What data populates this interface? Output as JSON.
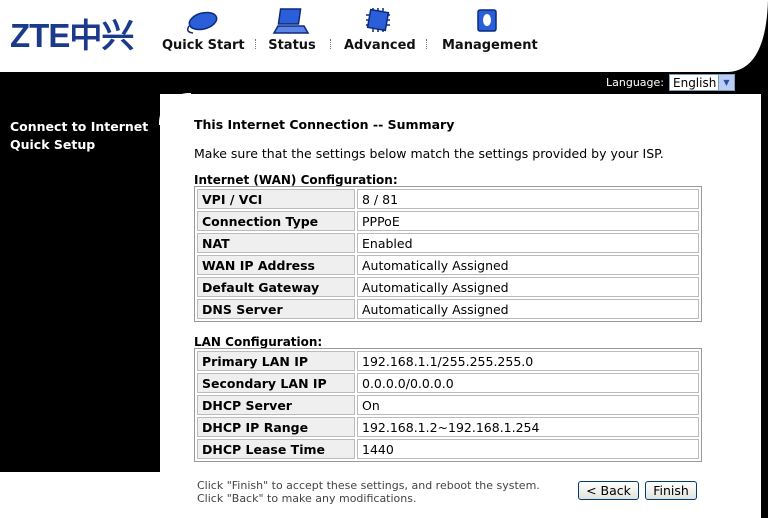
{
  "brand": {
    "logo_text": "ZTE中兴"
  },
  "nav": [
    {
      "label": "Quick Start",
      "icon": "mouse-icon"
    },
    {
      "label": "Status",
      "icon": "laptop-icon"
    },
    {
      "label": "Advanced",
      "icon": "chip-icon"
    },
    {
      "label": "Management",
      "icon": "book-icon"
    }
  ],
  "language": {
    "label": "Language:",
    "selected": "English"
  },
  "sidebar": {
    "items": [
      "Connect to Internet",
      "Quick Setup"
    ]
  },
  "page": {
    "title": "This Internet Connection -- Summary",
    "intro": "Make sure that the settings below match the settings provided by your ISP."
  },
  "wan": {
    "heading": "Internet (WAN) Configuration:",
    "rows": [
      {
        "key": "VPI / VCI",
        "value": "8 / 81"
      },
      {
        "key": "Connection Type",
        "value": "PPPoE"
      },
      {
        "key": "NAT",
        "value": "Enabled"
      },
      {
        "key": "WAN IP Address",
        "value": "Automatically Assigned"
      },
      {
        "key": "Default Gateway",
        "value": "Automatically Assigned"
      },
      {
        "key": "DNS Server",
        "value": "Automatically Assigned"
      }
    ]
  },
  "lan": {
    "heading": "LAN Configuration:",
    "rows": [
      {
        "key": "Primary LAN IP",
        "value": "192.168.1.1/255.255.255.0"
      },
      {
        "key": "Secondary LAN IP",
        "value": "0.0.0.0/0.0.0.0"
      },
      {
        "key": "DHCP Server",
        "value": "On"
      },
      {
        "key": "DHCP IP Range",
        "value": "192.168.1.2~192.168.1.254"
      },
      {
        "key": "DHCP Lease Time",
        "value": "1440"
      }
    ]
  },
  "footer": {
    "note1": "Click \"Finish\" to accept these settings, and reboot the system.",
    "note2": "Click \"Back\" to make any modifications.",
    "back_label": "< Back",
    "finish_label": "Finish"
  },
  "colors": {
    "brand_blue": "#1b3a8c",
    "frame": "#000000"
  }
}
